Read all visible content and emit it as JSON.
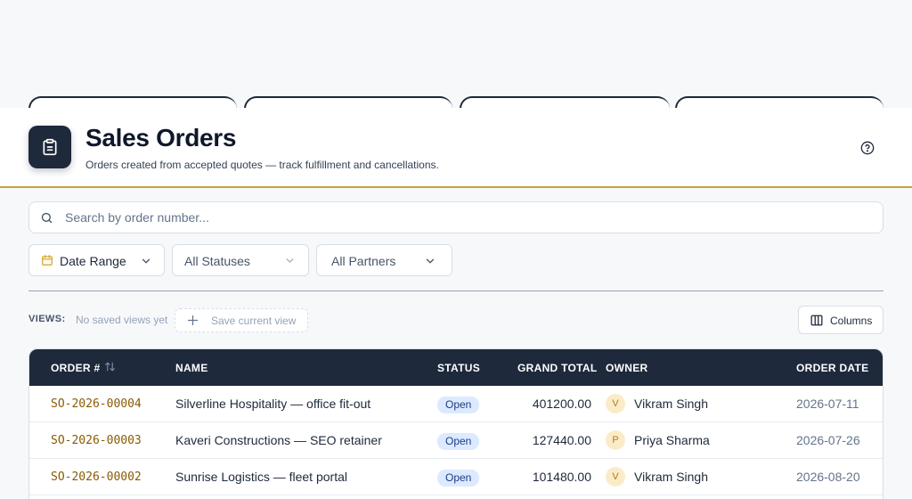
{
  "header": {
    "title": "Sales Orders",
    "subtitle": "Orders created from accepted quotes — track fulfillment and cancellations."
  },
  "search": {
    "placeholder": "Search by order number...",
    "value": ""
  },
  "filters": {
    "date_range": "Date Range",
    "statuses": "All Statuses",
    "partners": "All Partners"
  },
  "views": {
    "label": "VIEWS:",
    "empty_text": "No saved views yet",
    "save_label": "Save current view"
  },
  "columns_button": "Columns",
  "table": {
    "columns": {
      "order_no": "ORDER #",
      "name": "NAME",
      "status": "STATUS",
      "grand_total": "GRAND TOTAL",
      "owner": "OWNER",
      "order_date": "ORDER DATE"
    },
    "rows": [
      {
        "order_no": "SO-2026-00004",
        "name": "Silverline Hospitality — office fit-out",
        "status": "Open",
        "grand_total": "401200.00",
        "owner_initial": "V",
        "owner": "Vikram Singh",
        "order_date": "2026-07-11"
      },
      {
        "order_no": "SO-2026-00003",
        "name": "Kaveri Constructions — SEO retainer",
        "status": "Open",
        "grand_total": "127440.00",
        "owner_initial": "P",
        "owner": "Priya Sharma",
        "order_date": "2026-07-26"
      },
      {
        "order_no": "SO-2026-00002",
        "name": "Sunrise Logistics — fleet portal",
        "status": "Open",
        "grand_total": "101480.00",
        "owner_initial": "V",
        "owner": "Vikram Singh",
        "order_date": "2026-08-20"
      }
    ]
  },
  "colors": {
    "brand_dark": "#1e293b",
    "accent_gold": "#c9a23a",
    "order_number": "#8a5a00",
    "status_open_bg": "#dbeafe"
  }
}
